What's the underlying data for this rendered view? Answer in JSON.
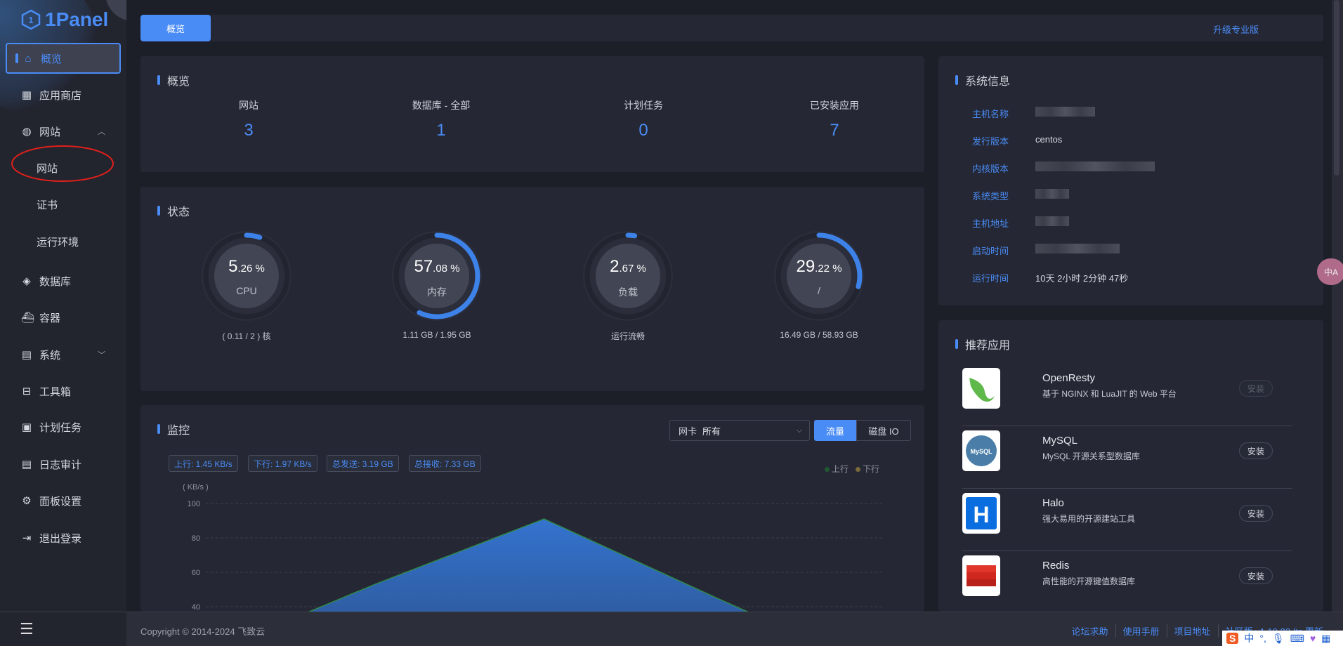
{
  "brand": {
    "name": "1Panel"
  },
  "sidebar": {
    "items": [
      {
        "label": "概览",
        "icon": "home-icon",
        "active": true
      },
      {
        "label": "应用商店",
        "icon": "grid-icon"
      },
      {
        "label": "网站",
        "icon": "globe-icon",
        "expanded": true
      },
      {
        "label": "网站",
        "sub": true,
        "annotated": true
      },
      {
        "label": "证书",
        "sub": true
      },
      {
        "label": "运行环境",
        "sub": true
      },
      {
        "label": "数据库",
        "icon": "layers-icon"
      },
      {
        "label": "容器",
        "icon": "docker-icon"
      },
      {
        "label": "系统",
        "icon": "server-icon",
        "collapsible": true
      },
      {
        "label": "工具箱",
        "icon": "toolbox-icon"
      },
      {
        "label": "计划任务",
        "icon": "calendar-icon"
      },
      {
        "label": "日志审计",
        "icon": "log-icon"
      },
      {
        "label": "面板设置",
        "icon": "gear-icon"
      },
      {
        "label": "退出登录",
        "icon": "logout-icon"
      }
    ]
  },
  "topbar": {
    "tab": "概览",
    "upgrade": "升级专业版"
  },
  "overview": {
    "title": "概览",
    "items": [
      {
        "label": "网站",
        "value": "3"
      },
      {
        "label": "数据库 - 全部",
        "value": "1"
      },
      {
        "label": "计划任务",
        "value": "0"
      },
      {
        "label": "已安装应用",
        "value": "7"
      }
    ]
  },
  "status": {
    "title": "状态",
    "gauges": [
      {
        "int": "5",
        "dec": ".26 %",
        "label": "CPU",
        "sub": "( 0.11 / 2 ) 核",
        "percent": 5.26
      },
      {
        "int": "57",
        "dec": ".08 %",
        "label": "内存",
        "sub": "1.11 GB / 1.95 GB",
        "percent": 57.08
      },
      {
        "int": "2",
        "dec": ".67 %",
        "label": "负载",
        "sub": "运行流畅",
        "percent": 2.67
      },
      {
        "int": "29",
        "dec": ".22 %",
        "label": "/",
        "sub": "16.49 GB / 58.93 GB",
        "percent": 29.22
      }
    ]
  },
  "monitor": {
    "title": "监控",
    "nic_label": "网卡",
    "nic_value": "所有",
    "tabs": [
      "流量",
      "磁盘 IO"
    ],
    "tags": [
      "上行: 1.45 KB/s",
      "下行: 1.97 KB/s",
      "总发送: 3.19 GB",
      "总接收: 7.33 GB"
    ]
  },
  "chart_data": {
    "type": "area",
    "ylabel": "( KB/s )",
    "ylim": [
      0,
      100
    ],
    "yticks": [
      "100",
      "80",
      "60",
      "40"
    ],
    "grid": true,
    "legend_position": "top-right",
    "series": [
      {
        "name": "上行",
        "values": [
          12,
          53,
          91,
          46,
          2
        ],
        "color": "#2f6fd0",
        "line_color": "#2f8a4a"
      },
      {
        "name": "下行",
        "color": "#8a7a4a"
      }
    ]
  },
  "sysinfo": {
    "title": "系统信息",
    "rows": [
      {
        "key": "主机名称",
        "value": "",
        "redacted": true
      },
      {
        "key": "发行版本",
        "value": "centos"
      },
      {
        "key": "内核版本",
        "value": "",
        "redacted": true
      },
      {
        "key": "系统类型",
        "value": "",
        "redacted": true
      },
      {
        "key": "主机地址",
        "value": "",
        "redacted": true
      },
      {
        "key": "启动时间",
        "value": "",
        "redacted": true
      },
      {
        "key": "运行时间",
        "value": "10天 2小时 2分钟 47秒"
      }
    ]
  },
  "recommended": {
    "title": "推荐应用",
    "install": "安装",
    "apps": [
      {
        "name": "OpenResty",
        "desc": "基于 NGINX 和 LuaJIT 的 Web 平台",
        "installed": true
      },
      {
        "name": "MySQL",
        "desc": "MySQL 开源关系型数据库"
      },
      {
        "name": "Halo",
        "desc": "强大易用的开源建站工具"
      },
      {
        "name": "Redis",
        "desc": "高性能的开源键值数据库"
      }
    ]
  },
  "footer": {
    "copyright": "Copyright © 2014-2024 飞致云",
    "links": [
      "论坛求助",
      "使用手册",
      "项目地址",
      "社区版 v1.10.22-lts 更新"
    ]
  },
  "ime": {
    "mode": "中"
  },
  "colors": {
    "accent": "#4a8cf5",
    "card": "#252734",
    "sidebar": "#22242e"
  }
}
